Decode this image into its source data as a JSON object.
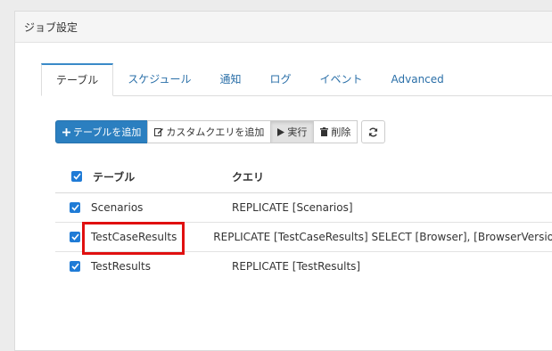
{
  "panel": {
    "title": "ジョブ設定"
  },
  "tabs": [
    {
      "label": "テーブル",
      "active": true
    },
    {
      "label": "スケジュール"
    },
    {
      "label": "通知"
    },
    {
      "label": "ログ"
    },
    {
      "label": "イベント"
    },
    {
      "label": "Advanced"
    }
  ],
  "toolbar": {
    "add_table": "テーブルを追加",
    "add_custom_query": "カスタムクエリを追加",
    "run": "実行",
    "delete": "削除"
  },
  "table": {
    "columns": {
      "table": "テーブル",
      "query": "クエリ"
    },
    "rows": [
      {
        "name": "Scenarios",
        "query": "REPLICATE [Scenarios]",
        "checked": true
      },
      {
        "name": "TestCaseResults",
        "query": "REPLICATE [TestCaseResults] SELECT [Browser], [BrowserVersion], [Capa",
        "checked": true
      },
      {
        "name": "TestResults",
        "query": "REPLICATE [TestResults]",
        "checked": true
      }
    ]
  },
  "colors": {
    "accent": "#2b7fc0",
    "checkbox": "#1f7bd6",
    "highlight": "#e01010"
  }
}
